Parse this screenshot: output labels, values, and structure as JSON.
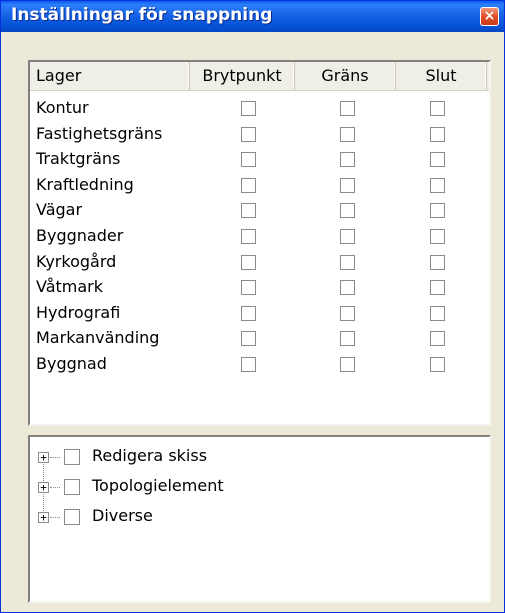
{
  "window": {
    "title": "Inställningar för snappning",
    "close_label": "×"
  },
  "table": {
    "headers": {
      "layer": "Lager",
      "vertex": "Brytpunkt",
      "edge": "Gräns",
      "end": "Slut"
    },
    "rows": [
      {
        "label": "Kontur",
        "vertex": false,
        "edge": false,
        "end": false
      },
      {
        "label": "Fastighetsgräns",
        "vertex": false,
        "edge": false,
        "end": false
      },
      {
        "label": "Traktgräns",
        "vertex": false,
        "edge": false,
        "end": false
      },
      {
        "label": "Kraftledning",
        "vertex": false,
        "edge": false,
        "end": false
      },
      {
        "label": "Vägar",
        "vertex": false,
        "edge": false,
        "end": false
      },
      {
        "label": "Byggnader",
        "vertex": false,
        "edge": false,
        "end": false
      },
      {
        "label": "Kyrkogård",
        "vertex": false,
        "edge": false,
        "end": false
      },
      {
        "label": "Våtmark",
        "vertex": false,
        "edge": false,
        "end": false
      },
      {
        "label": "Hydrografi",
        "vertex": false,
        "edge": false,
        "end": false
      },
      {
        "label": "Markanvänding",
        "vertex": false,
        "edge": false,
        "end": false
      },
      {
        "label": "Byggnad",
        "vertex": false,
        "edge": false,
        "end": false
      }
    ]
  },
  "tree": {
    "items": [
      {
        "label": "Redigera skiss",
        "expander": "+",
        "checked": false
      },
      {
        "label": "Topologielement",
        "expander": "+",
        "checked": false
      },
      {
        "label": "Diverse",
        "expander": "+",
        "checked": false
      }
    ]
  },
  "colors": {
    "titlebar": "#0652d6",
    "close_button": "#e2502a",
    "window_bg": "#ece9d8"
  }
}
